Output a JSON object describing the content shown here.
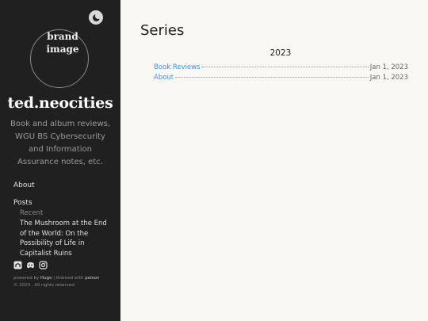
{
  "sidebar": {
    "brand_image": "brand image",
    "site_title": "ted.neocities",
    "description": "Book and album reviews, WGU BS Cybersecurity and Information Assurance notes, etc.",
    "nav": {
      "about": "About",
      "posts": "Posts",
      "recent": "Recent",
      "recent_post": "The Mushroom at the End of the World: On the Possibility of Life in Capitalist Ruins"
    },
    "social_icons": [
      "github-icon",
      "discord-icon",
      "instagram-icon"
    ],
    "footer": {
      "powered_by": "powered by",
      "hugo": "Hugo",
      "themed_with": "| themed with",
      "poison": "poison",
      "copyright": "© 2023 . All rights reserved."
    }
  },
  "main": {
    "title": "Series",
    "year": "2023",
    "items": [
      {
        "title": "Book Reviews",
        "date": "Jan 1, 2023"
      },
      {
        "title": "About",
        "date": "Jan 1, 2023"
      }
    ]
  },
  "colors": {
    "sidebar_bg": "#202020",
    "page_bg": "#f9f8f5",
    "link": "#4a8fd0"
  }
}
